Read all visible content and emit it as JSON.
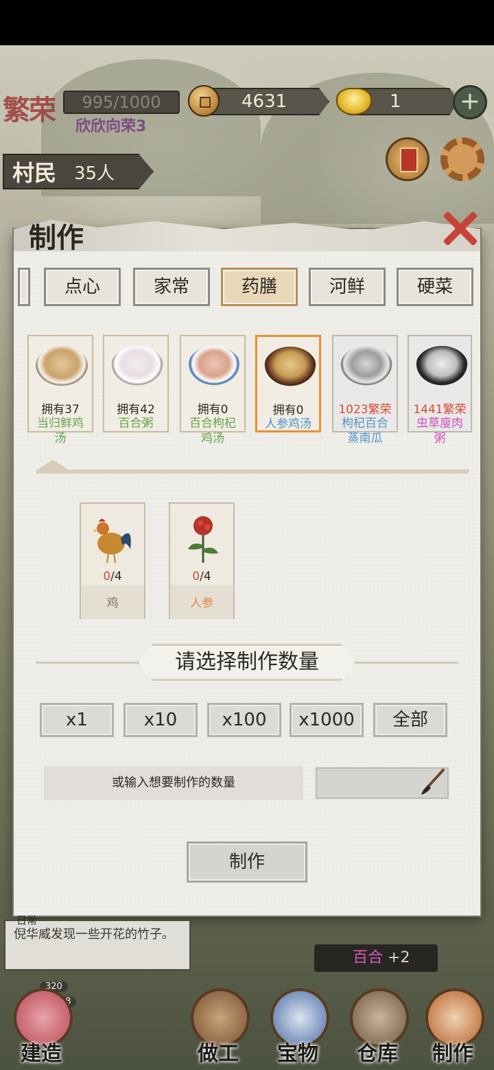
{
  "hud": {
    "prosperity_title": "繁荣",
    "prosperity_value": "995/1000",
    "prosperity_level": "欣欣向荣3",
    "coins": "4631",
    "gold": "1",
    "plus_icon": "plus-icon",
    "villager_label": "村民",
    "villager_count": "35人"
  },
  "panel": {
    "title": "制作",
    "tabs": [
      "点心",
      "家常",
      "药膳",
      "河鲜",
      "硬菜"
    ],
    "active_tab": "药膳",
    "recipes": [
      {
        "status": "拥有37",
        "name1": "当归鲜鸡",
        "name2": "汤"
      },
      {
        "status": "拥有42",
        "name1": "百合粥",
        "name2": ""
      },
      {
        "status": "拥有0",
        "name1": "百合枸杞",
        "name2": "鸡汤"
      },
      {
        "status": "拥有0",
        "name1": "人参鸡汤",
        "name2": ""
      },
      {
        "status": "1023繁荣",
        "name1": "枸杞百合",
        "name2": "蒸南瓜"
      },
      {
        "status": "1441繁荣",
        "name1": "虫草廋肉",
        "name2": "粥"
      }
    ],
    "ingredients": [
      {
        "have": "0",
        "need": "/4",
        "name": "鸡"
      },
      {
        "have": "0",
        "need": "/4",
        "name": "人参"
      }
    ],
    "qty_title": "请选择制作数量",
    "qty_buttons": [
      "x1",
      "x10",
      "x100",
      "x1000",
      "全部"
    ],
    "input_label": "或输入想要制作的数量",
    "input_value": "",
    "make_button": "制作"
  },
  "bottom": {
    "log_tag": "日常",
    "log_text": "倪华威发现一些开花的竹子。",
    "toast_item": "百合",
    "toast_count": "+2",
    "stat1": "320",
    "stat2": "00:28",
    "nav": [
      "建造",
      "做工",
      "宝物",
      "仓库",
      "制作"
    ]
  }
}
